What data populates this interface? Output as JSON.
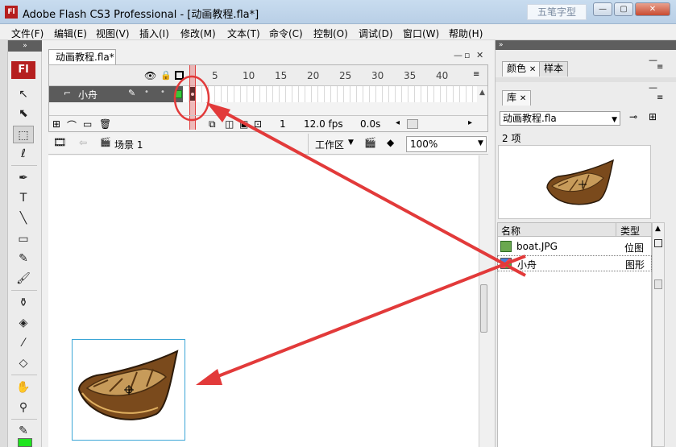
{
  "window": {
    "app_icon": "Fl",
    "title": "Adobe Flash CS3 Professional - [动画教程.fla*]",
    "watermark": "五笔字型",
    "minimize": "—",
    "maximize": "▢",
    "close": "✕"
  },
  "menu": [
    "文件(F)",
    "编辑(E)",
    "视图(V)",
    "插入(I)",
    "修改(M)",
    "文本(T)",
    "命令(C)",
    "控制(O)",
    "调试(D)",
    "窗口(W)",
    "帮助(H)"
  ],
  "tools": {
    "logo": "Fl",
    "items": [
      "selection-tool",
      "subselection-tool",
      "free-transform-tool",
      "lasso-tool",
      "pen-tool",
      "text-tool",
      "line-tool",
      "rectangle-tool",
      "pencil-tool",
      "brush-tool",
      "ink-bottle-tool",
      "paint-bucket-tool",
      "eyedropper-tool",
      "eraser-tool",
      "hand-tool",
      "zoom-tool",
      "stroke-color-tool"
    ],
    "fill_color": "#1ee51e"
  },
  "document": {
    "tab": "动画教程.fla*",
    "timeline": {
      "frame_numbers": [
        "5",
        "10",
        "15",
        "20",
        "25",
        "30",
        "35",
        "40"
      ],
      "layer_name": "小舟",
      "current_frame": "1",
      "fps": "12.0 fps",
      "elapsed": "0.0s"
    },
    "scene": {
      "name": "场景 1",
      "workspace": "工作区",
      "zoom": "100%"
    }
  },
  "panels": {
    "color_tab": "颜色",
    "swatch_tab": "样本",
    "library_tab": "库",
    "library_file": "动画教程.fla",
    "item_count": "2 项",
    "col_name": "名称",
    "col_type": "类型",
    "items": [
      {
        "name": "boat.JPG",
        "type": "位图"
      },
      {
        "name": "小舟",
        "type": "图形"
      }
    ]
  },
  "annotation_color": "#e23a3a"
}
